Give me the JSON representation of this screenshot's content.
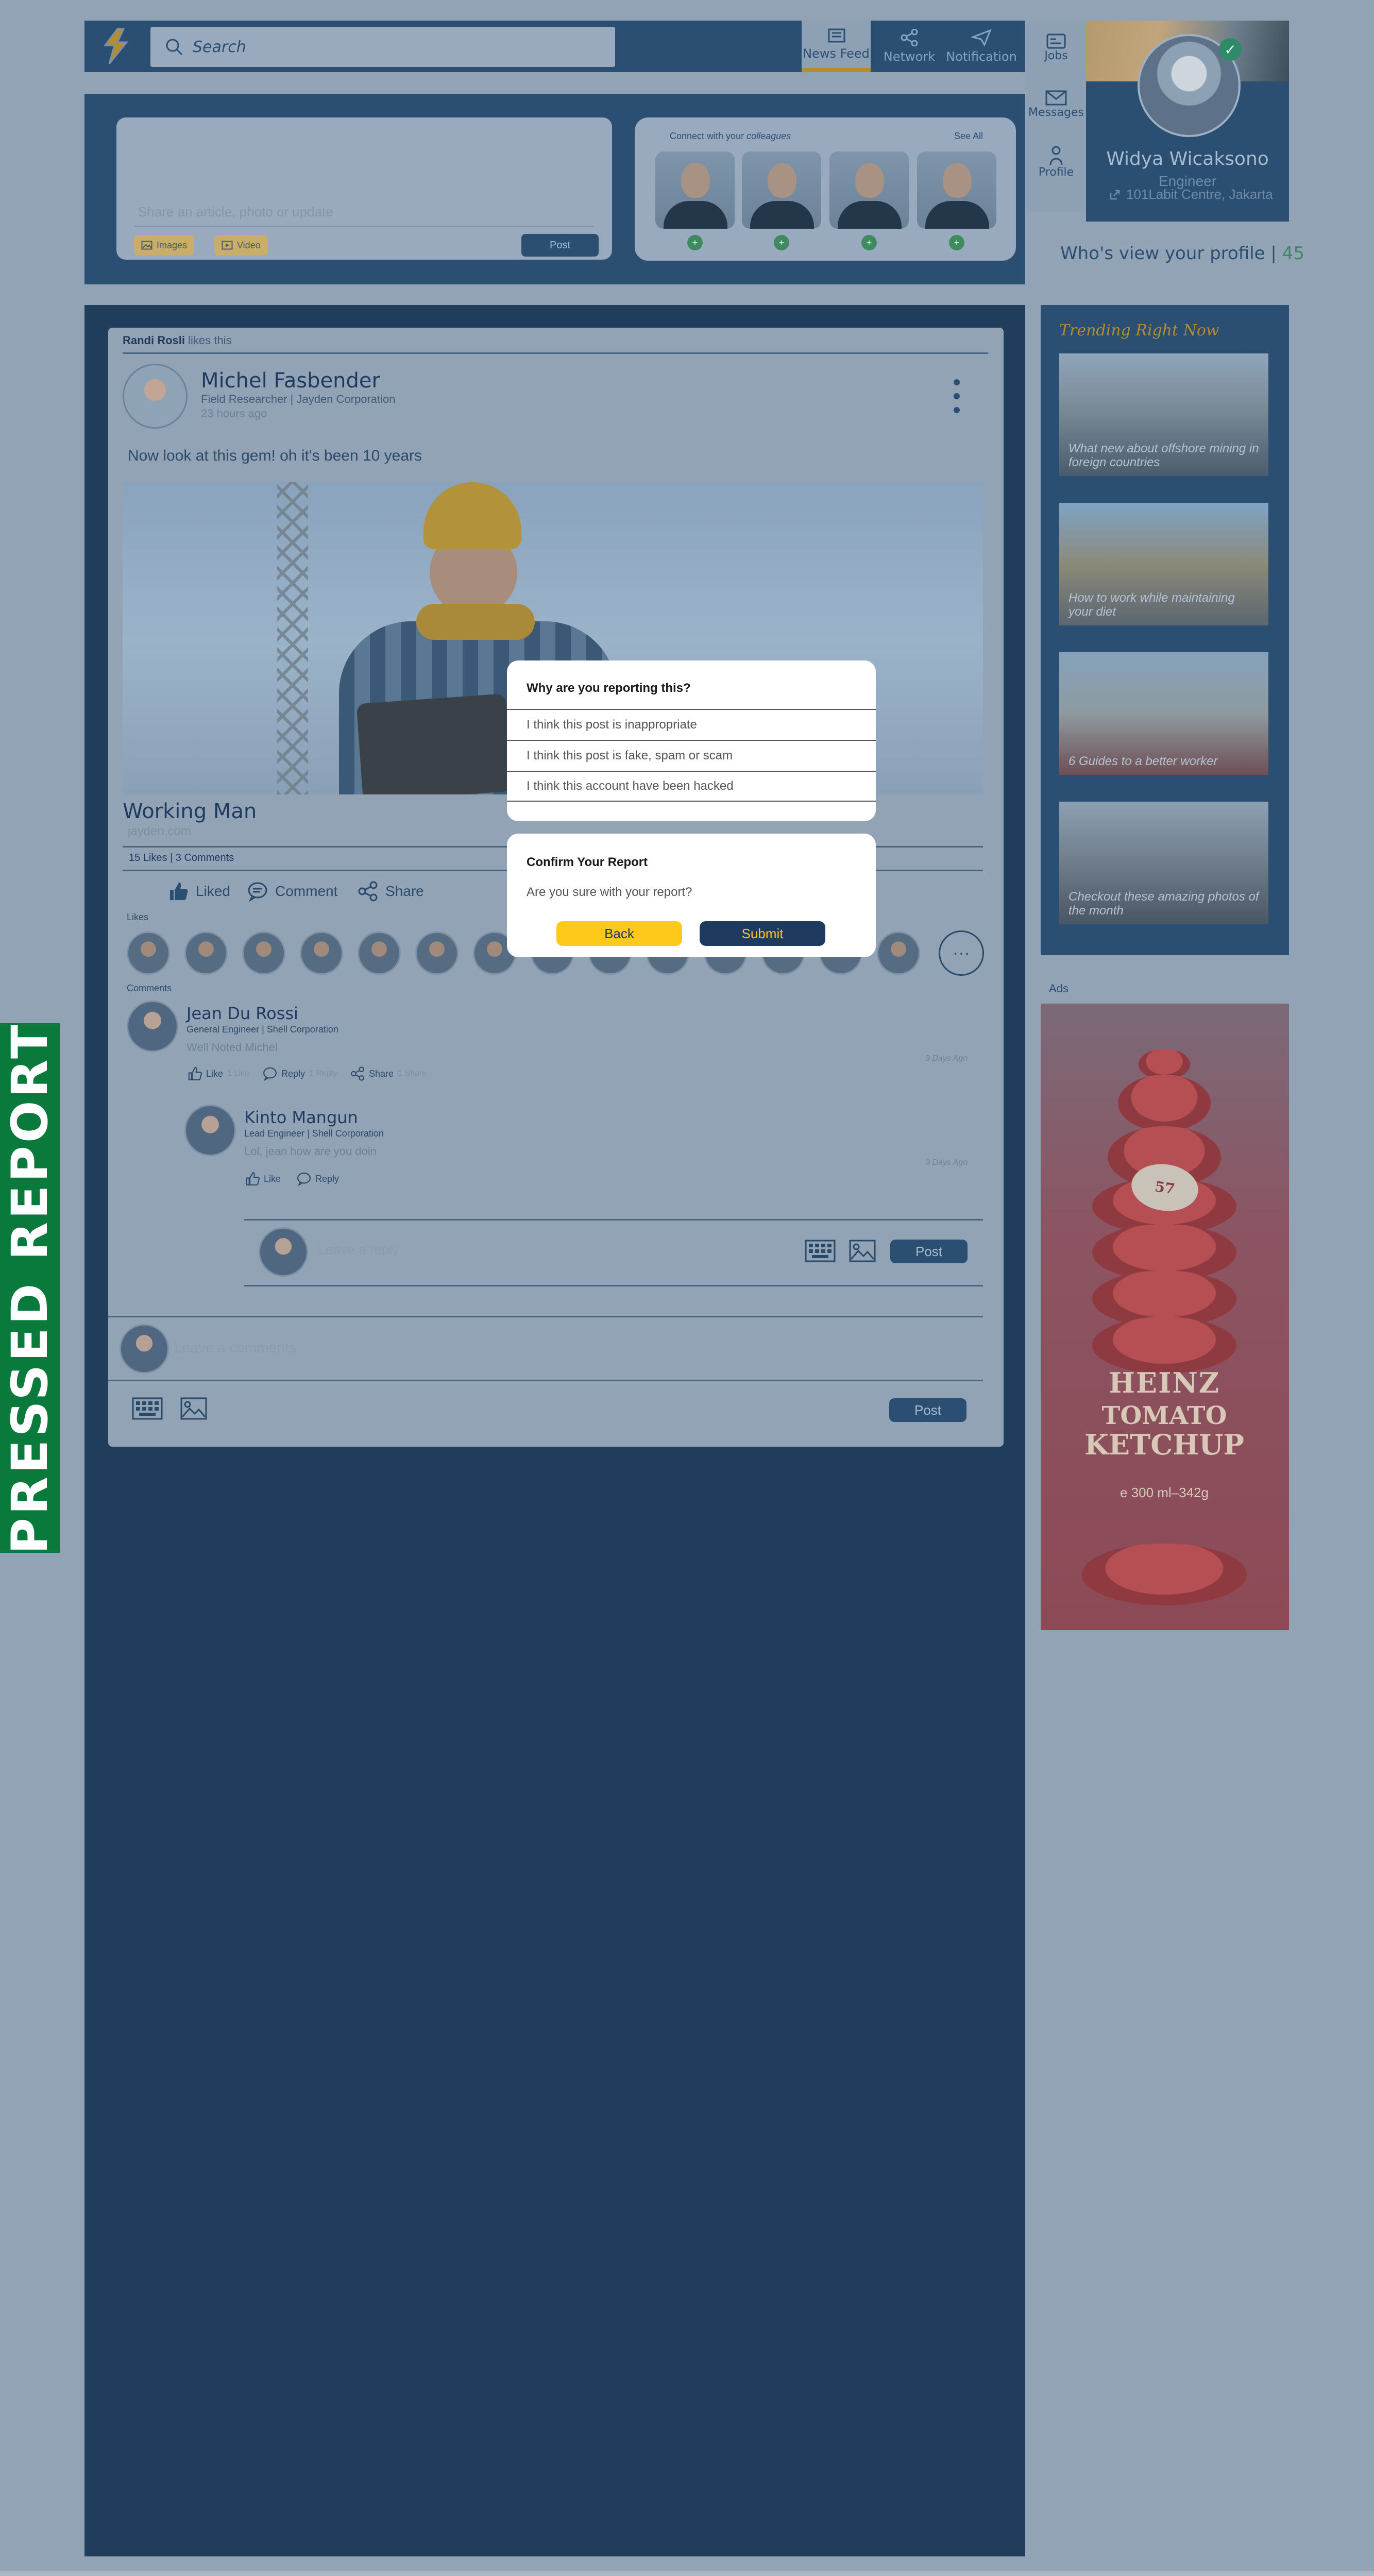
{
  "nav": {
    "search_placeholder": "Search",
    "items": [
      {
        "label": "News Feed",
        "icon": "newspaper-icon",
        "active": true
      },
      {
        "label": "Network",
        "icon": "share-icon"
      },
      {
        "label": "Notification",
        "icon": "paper-plane-icon"
      }
    ],
    "side": [
      {
        "label": "Jobs",
        "icon": "jobs-icon"
      },
      {
        "label": "Messages",
        "icon": "envelope-icon"
      },
      {
        "label": "Profile",
        "icon": "person-icon"
      }
    ]
  },
  "profile": {
    "name": "Widya Wicaksono",
    "role": "Engineer",
    "location": "101Labit Centre, Jakarta",
    "views_label": "Who's view your profile |",
    "views_count": "45"
  },
  "composer": {
    "placeholder": "Share an article, photo or update",
    "images_label": "Images",
    "video_label": "Video",
    "post_label": "Post"
  },
  "connect": {
    "title_prefix": "Connect with your",
    "title_emph": "colleagues",
    "see_all": "See All"
  },
  "post": {
    "liker_name": "Randi Rosli",
    "liker_text": "likes this",
    "author": "Michel Fasbender",
    "author_role": "Field Researcher | Jayden Corporation",
    "time": "23 hours ago",
    "text": "Now look at this gem! oh it's been 10 years",
    "image_title": "Working Man",
    "image_source": "jayden.com",
    "stats": "15 Likes | 3 Comments",
    "actions": {
      "liked": "Liked",
      "comment": "Comment",
      "share": "Share"
    },
    "likes_label": "Likes",
    "comments_label": "Comments"
  },
  "comments": [
    {
      "name": "Jean Du Rossi",
      "role": "General Engineer | Shell Corporation",
      "text": "Well Noted Michel",
      "date": "3 Days Ago",
      "like": "Like",
      "like_count": "1 Like",
      "reply": "Reply",
      "reply_count": "1 Reply",
      "share": "Share",
      "share_count": "1 Share"
    },
    {
      "name": "Kinto Mangun",
      "role": "Lead Engineer | Shell Corporation",
      "text": "Lol, jean how are you doin",
      "date": "3 Days Ago",
      "like": "Like",
      "reply": "Reply"
    }
  ],
  "reply_box": {
    "placeholder": "Leave a reply",
    "post_label": "Post"
  },
  "comment_box": {
    "placeholder": "Leave a comments",
    "post_label": "Post"
  },
  "trending": {
    "title": "Trending Right Now",
    "items": [
      {
        "caption": "What new about offshore mining in foreign countries"
      },
      {
        "caption": "How to work while maintaining your diet"
      },
      {
        "caption": "6 Guides to a better worker"
      },
      {
        "caption": "Checkout these amazing photos of the month"
      }
    ]
  },
  "ads": {
    "label": "Ads",
    "brand": "HEINZ",
    "product_line1": "TOMATO",
    "product_line2": "KETCHUP",
    "size": "e 300 ml–342g",
    "badge": "57"
  },
  "report_modal": {
    "title": "Why are you reporting this?",
    "reasons": [
      "I think this post is inappropriate",
      "I think this post is fake, spam or scam",
      "I think this account have been hacked"
    ]
  },
  "confirm_modal": {
    "title": "Confirm Your Report",
    "text": "Are you sure with your report?",
    "back": "Back",
    "submit": "Submit"
  },
  "tag": {
    "label": "PRESSED REPORT"
  },
  "colors": {
    "navy": "#2a4f72",
    "dark_navy": "#203d5b",
    "overlay": "#93a3b6",
    "gold": "#ffc91a",
    "green": "#0a7a3c"
  }
}
